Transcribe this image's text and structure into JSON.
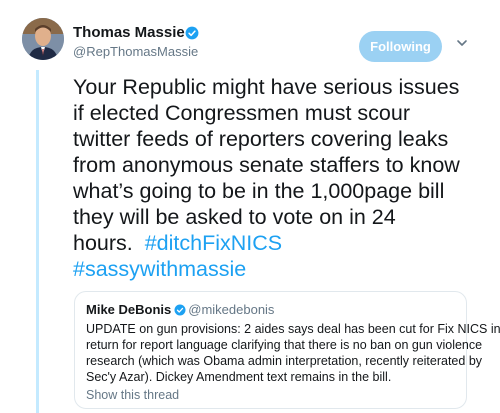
{
  "tweet": {
    "author": {
      "name": "Thomas Massie",
      "handle": "@RepThomasMassie",
      "verified": true
    },
    "follow_label": "Following",
    "text_lines": [
      "Your Republic might have serious issues",
      "if elected Congressmen must scour",
      "twitter feeds of reporters covering leaks",
      "from anonymous senate staffers to know",
      "what’s going to be in the 1,000page bill",
      "they will be asked to vote on in 24"
    ],
    "last_line_text": "hours.",
    "hashtags": [
      "#ditchFixNICS",
      "#sassywithmassie"
    ]
  },
  "quoted_tweet": {
    "author_name": "Mike DeBonis",
    "author_handle": "@mikedebonis",
    "verified": true,
    "text_lines": [
      "UPDATE on gun provisions: 2 aides says deal has been cut for Fix NICS in",
      "return for report language clarifying that there is no ban on gun violence",
      "research (which was Obama admin interpretation, recently reiterated by",
      "Sec'y Azar). Dickey Amendment text remains in the bill."
    ],
    "show_thread_label": "Show this thread"
  },
  "colors": {
    "link_blue": "#1da1f2",
    "follow_button_bg": "#9bd1f3",
    "thread_line": "#c4eaff",
    "secondary_text": "#657786"
  }
}
